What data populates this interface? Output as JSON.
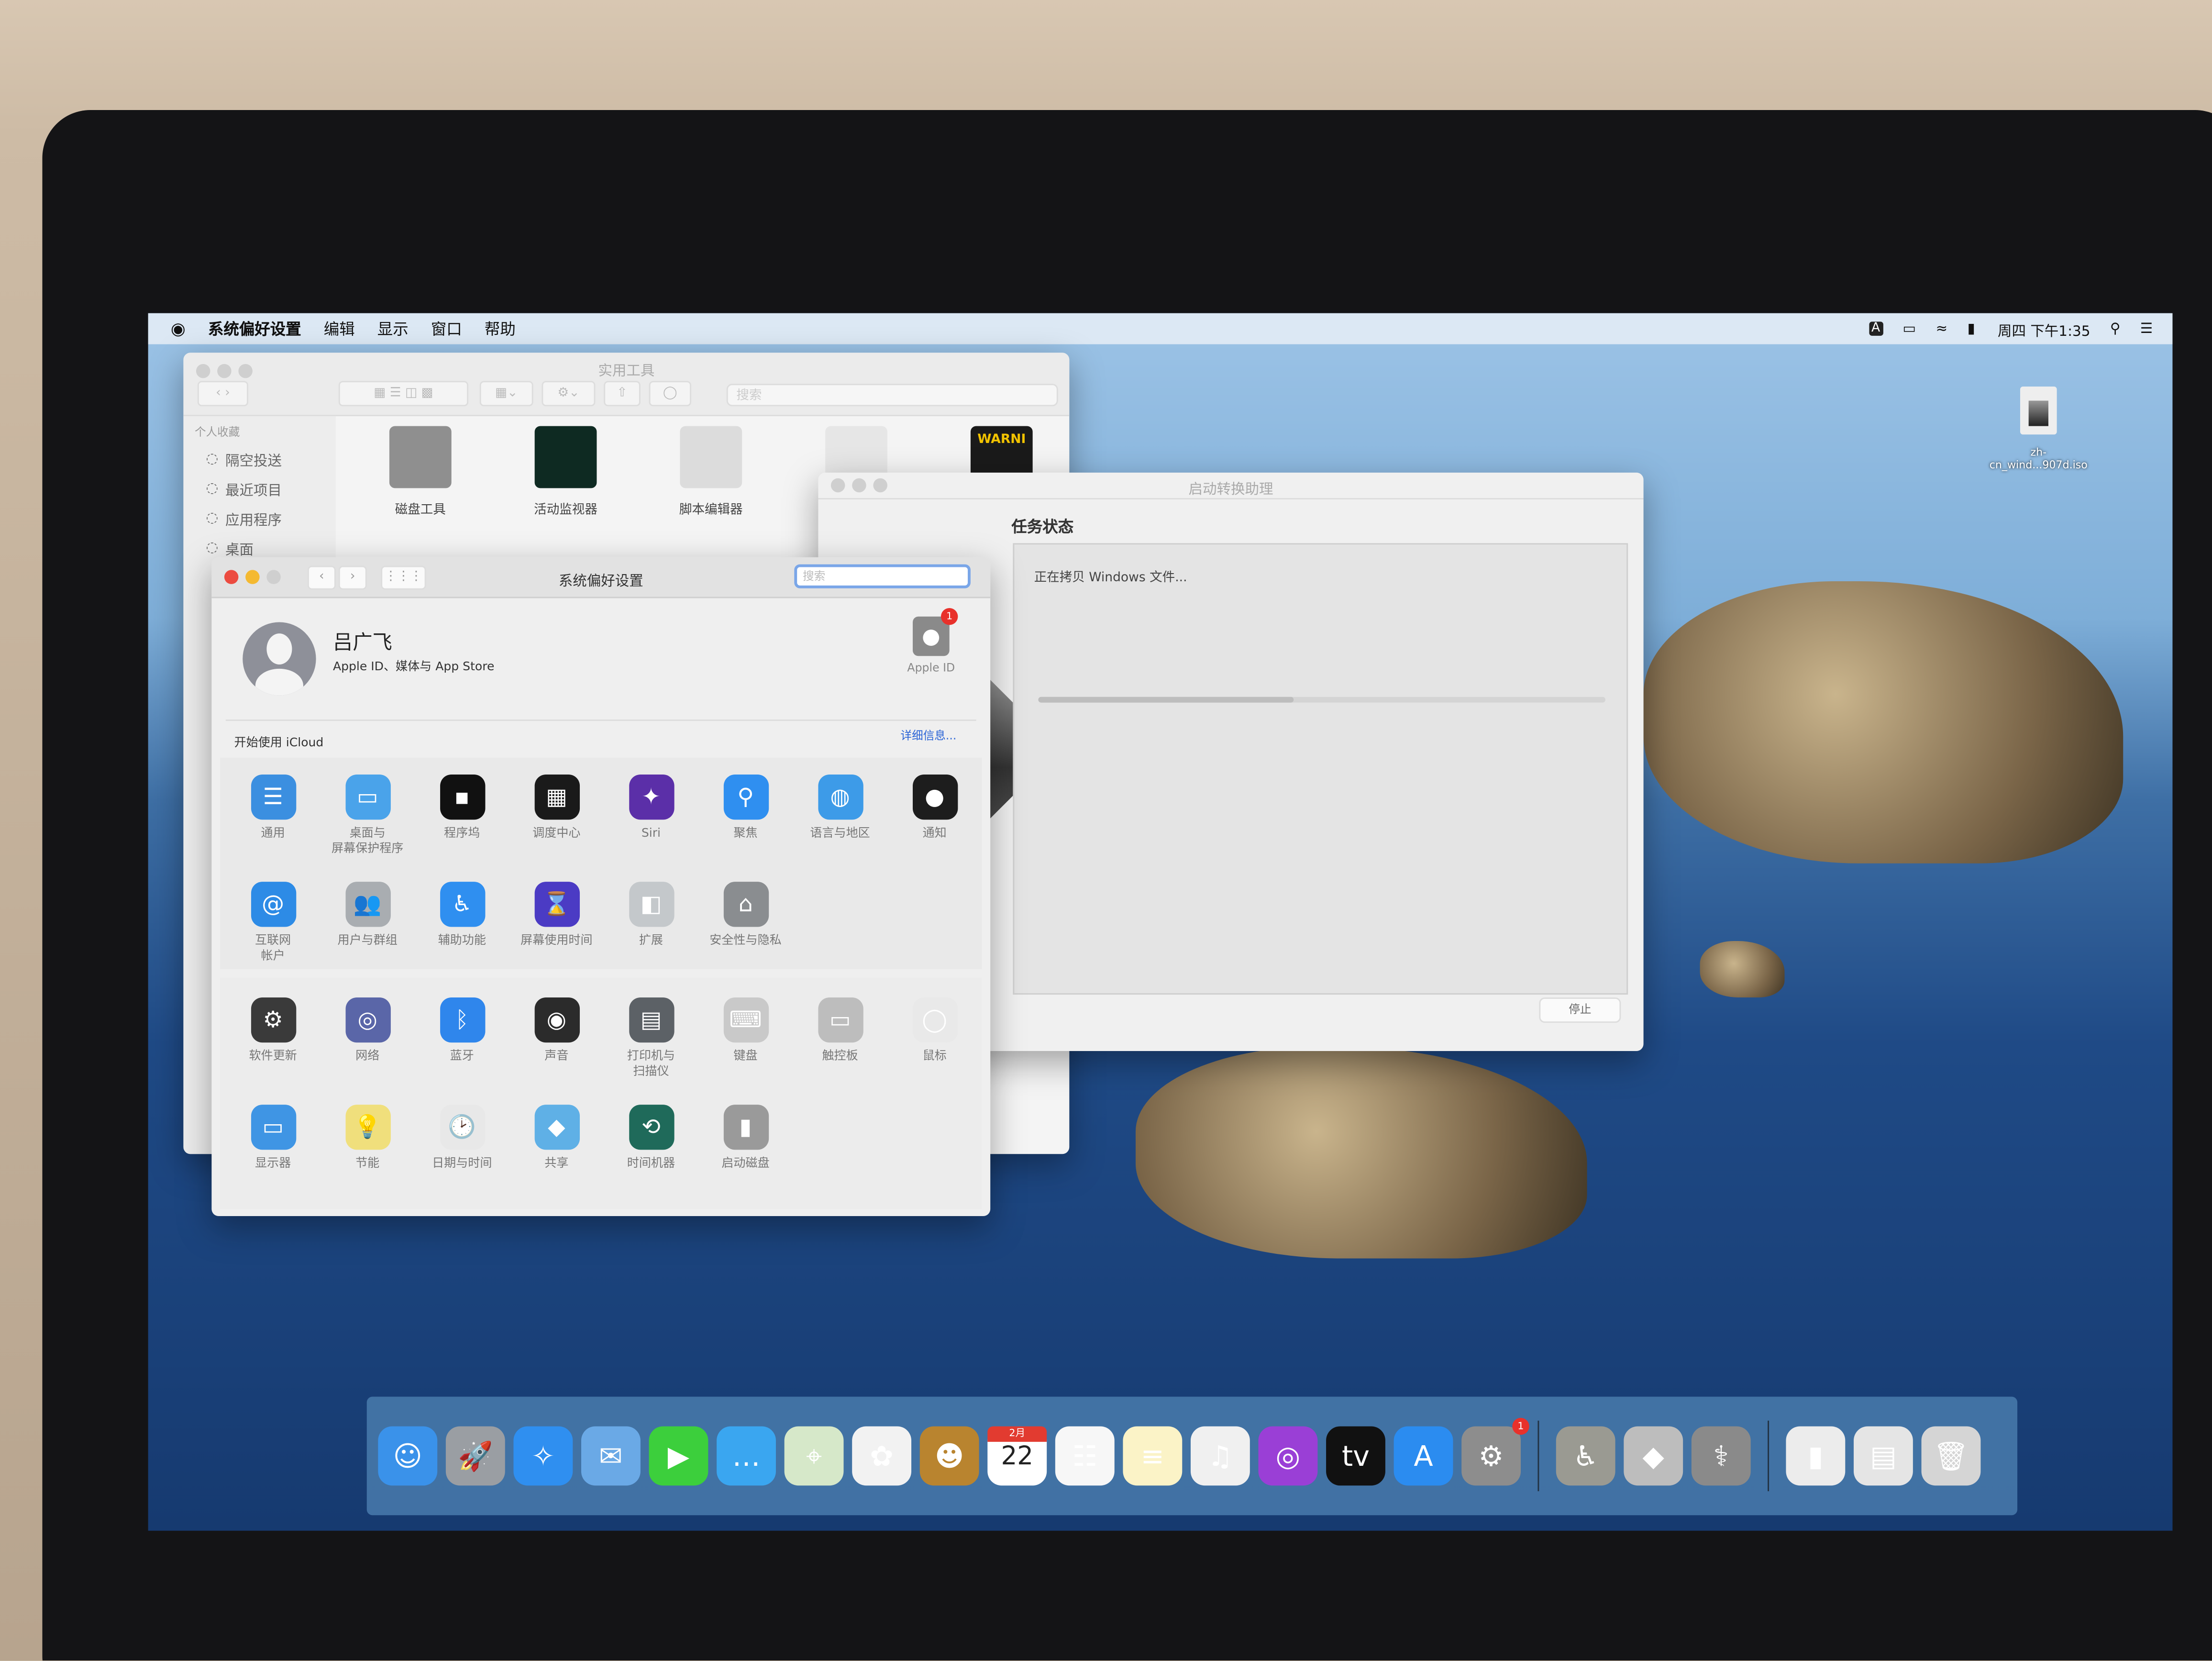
{
  "menubar": {
    "apple_icon": "apple-logo-icon",
    "app_name": "系统偏好设置",
    "items": [
      "编辑",
      "显示",
      "窗口",
      "帮助"
    ],
    "input_source": "A",
    "clock": "周四 下午1:35",
    "status_icons": [
      "airplay-icon",
      "wifi-icon",
      "battery-icon",
      "spotlight-icon",
      "notification-center-icon"
    ]
  },
  "finder": {
    "title": "实用工具",
    "search_placeholder": "搜索",
    "sidebar_header": "个人收藏",
    "sidebar": [
      {
        "label": "隔空投送",
        "icon": "airdrop-icon"
      },
      {
        "label": "最近项目",
        "icon": "recents-icon"
      },
      {
        "label": "应用程序",
        "icon": "applications-icon"
      },
      {
        "label": "桌面",
        "icon": "desktop-icon"
      }
    ],
    "apps": [
      {
        "label": "磁盘工具",
        "icon": "disk-utility-icon",
        "color": "#8f8f8f"
      },
      {
        "label": "活动监视器",
        "icon": "activity-monitor-icon",
        "color": "#0e2a22"
      },
      {
        "label": "脚本编辑器",
        "icon": "script-editor-icon",
        "color": "#dcdcdc"
      },
      {
        "label": "",
        "icon": "screenshot-icon",
        "color": "#e6e6e6"
      },
      {
        "label": "",
        "icon": "console-icon",
        "color": "#1a1a1a",
        "text": "WARNI"
      }
    ]
  },
  "bootcamp": {
    "title": "启动转换助理",
    "heading": "任务状态",
    "status": "正在拷贝 Windows 文件...",
    "progress_percent": 45,
    "stop_label": "停止"
  },
  "prefs": {
    "title": "系统偏好设置",
    "search_placeholder": "搜索",
    "user_name": "吕广飞",
    "user_subtitle": "Apple ID、媒体与 App Store",
    "apple_id_label": "Apple ID",
    "apple_id_badge": "1",
    "icloud_prompt": "开始使用 iCloud",
    "details_link": "详细信息...",
    "colors": {
      "accent": "#2a63d6",
      "badge": "#e8312b"
    },
    "sections": [
      [
        {
          "label": "通用",
          "icon": "general-icon",
          "color": "#3b8fe0"
        },
        {
          "label": "桌面与\n屏幕保护程序",
          "icon": "desktop-screensaver-icon",
          "color": "#4aa3ea"
        },
        {
          "label": "程序坞",
          "icon": "dock-icon",
          "color": "#111111"
        },
        {
          "label": "调度中心",
          "icon": "mission-control-icon",
          "color": "#1a1a1a"
        },
        {
          "label": "Siri",
          "icon": "siri-icon",
          "color": "#5b2fa8"
        },
        {
          "label": "聚焦",
          "icon": "spotlight-icon",
          "color": "#2f8ff0"
        },
        {
          "label": "语言与地区",
          "icon": "language-region-icon",
          "color": "#3d9be8"
        },
        {
          "label": "通知",
          "icon": "notifications-icon",
          "color": "#1d1d1d"
        },
        {
          "label": "互联网\n帐户",
          "icon": "internet-accounts-icon",
          "color": "#2d8be6"
        },
        {
          "label": "用户与群组",
          "icon": "users-groups-icon",
          "color": "#a9adb1"
        },
        {
          "label": "辅助功能",
          "icon": "accessibility-icon",
          "color": "#2f8ff0"
        },
        {
          "label": "屏幕使用时间",
          "icon": "screen-time-icon",
          "color": "#4b3bc4"
        },
        {
          "label": "扩展",
          "icon": "extensions-icon",
          "color": "#c4c8cb"
        },
        {
          "label": "安全性与隐私",
          "icon": "security-privacy-icon",
          "color": "#8a8d90"
        }
      ],
      [
        {
          "label": "软件更新",
          "icon": "software-update-icon",
          "color": "#3a3a3a"
        },
        {
          "label": "网络",
          "icon": "network-icon",
          "color": "#5a66a8"
        },
        {
          "label": "蓝牙",
          "icon": "bluetooth-icon",
          "color": "#2f86ec"
        },
        {
          "label": "声音",
          "icon": "sound-icon",
          "color": "#2b2b2b"
        },
        {
          "label": "打印机与\n扫描仪",
          "icon": "printers-scanners-icon",
          "color": "#5c6166"
        },
        {
          "label": "键盘",
          "icon": "keyboard-icon",
          "color": "#c9c9c9"
        },
        {
          "label": "触控板",
          "icon": "trackpad-icon",
          "color": "#bdbdbd"
        },
        {
          "label": "鼠标",
          "icon": "mouse-icon",
          "color": "#e9e9e9"
        },
        {
          "label": "显示器",
          "icon": "displays-icon",
          "color": "#3f95e4"
        },
        {
          "label": "节能",
          "icon": "energy-saver-icon",
          "color": "#f0df7c"
        },
        {
          "label": "日期与时间",
          "icon": "date-time-icon",
          "color": "#e8e8e8"
        },
        {
          "label": "共享",
          "icon": "sharing-icon",
          "color": "#5fb0e6"
        },
        {
          "label": "时间机器",
          "icon": "time-machine-icon",
          "color": "#1f6a5a"
        },
        {
          "label": "启动磁盘",
          "icon": "startup-disk-icon",
          "color": "#9a9a9a"
        }
      ]
    ]
  },
  "desktop": {
    "file_line1": "zh-",
    "file_line2": "cn_wind...907d.iso",
    "file_icon": "disk-image-icon"
  },
  "dock": {
    "calendar_month": "2月",
    "calendar_day": "22",
    "system_prefs_badge": "1",
    "apps": [
      {
        "icon": "finder-icon",
        "color": "#3a92ea"
      },
      {
        "icon": "launchpad-icon",
        "color": "#9a9ea3"
      },
      {
        "icon": "safari-icon",
        "color": "#2f8ff0"
      },
      {
        "icon": "mail-icon",
        "color": "#6aa9e6"
      },
      {
        "icon": "facetime-icon",
        "color": "#3ccf3c"
      },
      {
        "icon": "messages-icon",
        "color": "#3aa6f0"
      },
      {
        "icon": "maps-icon",
        "color": "#d6e8c9"
      },
      {
        "icon": "photos-icon",
        "color": "#f2f2f2"
      },
      {
        "icon": "contacts-icon",
        "color": "#b9842f"
      },
      {
        "icon": "calendar-icon",
        "color": "#ffffff"
      },
      {
        "icon": "reminders-icon",
        "color": "#f7f7f7"
      },
      {
        "icon": "notes-icon",
        "color": "#fbf3c7"
      },
      {
        "icon": "music-icon",
        "color": "#f0f0f0"
      },
      {
        "icon": "podcasts-icon",
        "color": "#9a3fd6"
      },
      {
        "icon": "apple-tv-icon",
        "color": "#111111"
      },
      {
        "icon": "app-store-icon",
        "color": "#2b8cf0"
      },
      {
        "icon": "system-preferences-icon",
        "color": "#8d8d8d"
      }
    ],
    "utilities": [
      {
        "icon": "voiceover-utility-icon",
        "color": "#9a9a92"
      },
      {
        "icon": "boot-camp-assistant-icon",
        "color": "#bdbdbd"
      },
      {
        "icon": "disk-utility-icon",
        "color": "#8a8a8a"
      }
    ],
    "stacks": [
      {
        "icon": "downloads-stack-icon",
        "color": "#ececec"
      },
      {
        "icon": "documents-stack-icon",
        "color": "#e5e5e5"
      },
      {
        "icon": "trash-icon",
        "color": "#d5d5d5"
      }
    ]
  }
}
